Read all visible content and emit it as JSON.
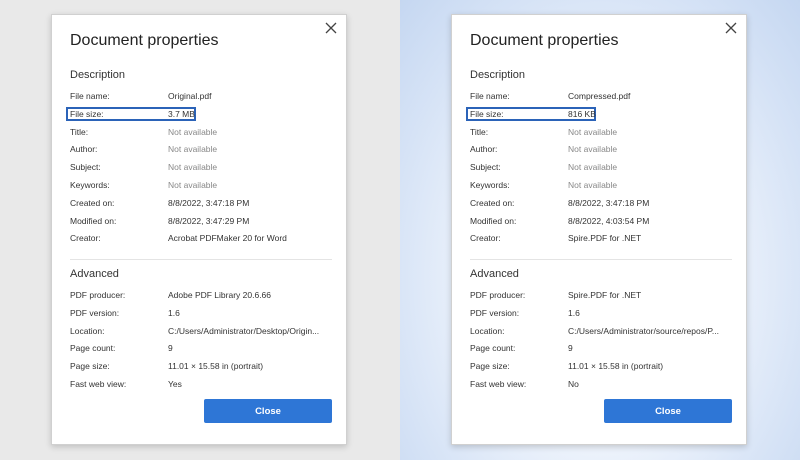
{
  "panels": [
    {
      "title": "Document properties",
      "description_heading": "Description",
      "advanced_heading": "Advanced",
      "close_label": "Close",
      "description": [
        {
          "label": "File name:",
          "value": "Original.pdf"
        },
        {
          "label": "File size:",
          "value": "3.7 MB"
        },
        {
          "label": "Title:",
          "value": "Not available"
        },
        {
          "label": "Author:",
          "value": "Not available"
        },
        {
          "label": "Subject:",
          "value": "Not available"
        },
        {
          "label": "Keywords:",
          "value": "Not available"
        },
        {
          "label": "Created on:",
          "value": "8/8/2022, 3:47:18 PM"
        },
        {
          "label": "Modified on:",
          "value": "8/8/2022, 3:47:29 PM"
        },
        {
          "label": "Creator:",
          "value": "Acrobat PDFMaker 20 for Word"
        }
      ],
      "advanced": [
        {
          "label": "PDF producer:",
          "value": "Adobe PDF Library 20.6.66"
        },
        {
          "label": "PDF version:",
          "value": "1.6"
        },
        {
          "label": "Location:",
          "value": "C:/Users/Administrator/Desktop/Origin..."
        },
        {
          "label": "Page count:",
          "value": "9"
        },
        {
          "label": "Page size:",
          "value": "11.01 × 15.58 in (portrait)"
        },
        {
          "label": "Fast web view:",
          "value": "Yes"
        }
      ]
    },
    {
      "title": "Document properties",
      "description_heading": "Description",
      "advanced_heading": "Advanced",
      "close_label": "Close",
      "description": [
        {
          "label": "File name:",
          "value": "Compressed.pdf"
        },
        {
          "label": "File size:",
          "value": "816 KB"
        },
        {
          "label": "Title:",
          "value": "Not available"
        },
        {
          "label": "Author:",
          "value": "Not available"
        },
        {
          "label": "Subject:",
          "value": "Not available"
        },
        {
          "label": "Keywords:",
          "value": "Not available"
        },
        {
          "label": "Created on:",
          "value": "8/8/2022, 3:47:18 PM"
        },
        {
          "label": "Modified on:",
          "value": "8/8/2022, 4:03:54 PM"
        },
        {
          "label": "Creator:",
          "value": "Spire.PDF for .NET"
        }
      ],
      "advanced": [
        {
          "label": "PDF producer:",
          "value": "Spire.PDF for .NET"
        },
        {
          "label": "PDF version:",
          "value": "1.6"
        },
        {
          "label": "Location:",
          "value": "C:/Users/Administrator/source/repos/P..."
        },
        {
          "label": "Page count:",
          "value": "9"
        },
        {
          "label": "Page size:",
          "value": "11.01 × 15.58 in (portrait)"
        },
        {
          "label": "Fast web view:",
          "value": "No"
        }
      ]
    }
  ]
}
